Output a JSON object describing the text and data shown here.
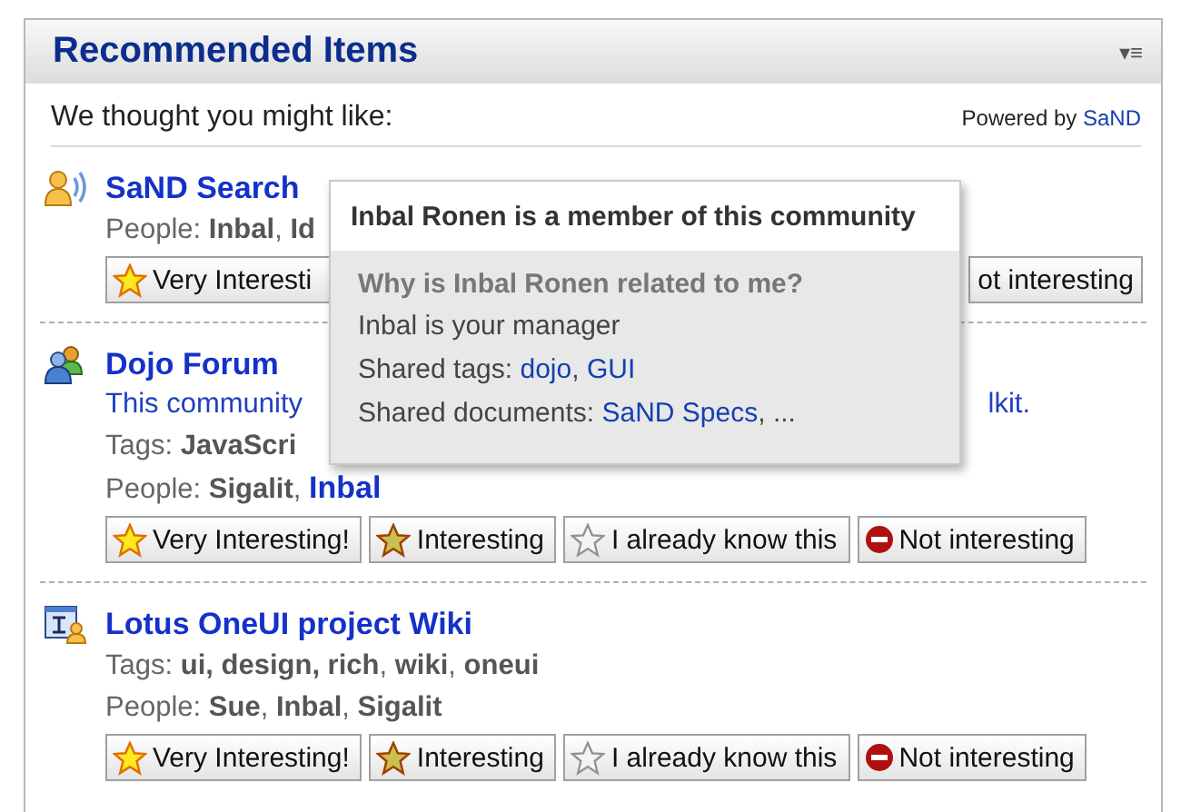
{
  "panel": {
    "title": "Recommended Items",
    "menu_glyph": "▾≡",
    "intro": "We thought you might like:",
    "powered_label": "Powered by",
    "powered_link": "SaND"
  },
  "items": [
    {
      "kind": "community",
      "title": "SaND Search",
      "lines": [
        [
          {
            "text": "People: **Inbal**, **Id**",
            "kind": "plain"
          }
        ]
      ],
      "buttons": [
        {
          "label": "Very Interesti",
          "kind": "very"
        },
        {
          "label": "ot interesting",
          "kind": "plain"
        }
      ],
      "buttons_split": true
    },
    {
      "kind": "forum",
      "title": "Dojo Forum",
      "description": [
        "This community",
        "lkit."
      ],
      "lines": [
        [
          {
            "text": "Tags: **JavaScri**",
            "kind": "plain"
          }
        ],
        [
          {
            "text": "People:  **Sigalit**,  ",
            "kind": "plain"
          },
          {
            "text": "Inbal",
            "kind": "link"
          }
        ]
      ],
      "buttons": [
        {
          "label": "Very Interesting!",
          "kind": "very"
        },
        {
          "label": "Interesting",
          "kind": "interesting"
        },
        {
          "label": "I already know this",
          "kind": "know"
        },
        {
          "label": "Not interesting",
          "kind": "not"
        }
      ],
      "buttons_split": false
    },
    {
      "kind": "wiki",
      "title": "Lotus OneUI project Wiki",
      "lines": [
        [
          {
            "text": "Tags: **ui, design, rich**, **wiki**, **oneui**",
            "kind": "plain"
          }
        ],
        [
          {
            "text": "People: **Sue**, **Inbal**, **Sigalit**",
            "kind": "plain"
          }
        ]
      ],
      "buttons": [
        {
          "label": "Very Interesting!",
          "kind": "very"
        },
        {
          "label": "Interesting",
          "kind": "interesting"
        },
        {
          "label": "I already know this",
          "kind": "know"
        },
        {
          "label": "Not interesting",
          "kind": "not"
        }
      ],
      "buttons_split": false
    }
  ],
  "tooltip": {
    "title": "Inbal Ronen is a member of this community",
    "question": "Why is Inbal Ronen related to me?",
    "reason": "Inbal is your manager",
    "lines": [
      [
        {
          "text": "Shared tags: ",
          "kind": "plain"
        },
        {
          "text": "dojo",
          "kind": "link"
        },
        {
          "text": ", ",
          "kind": "plain"
        },
        {
          "text": "GUI",
          "kind": "link"
        }
      ],
      [
        {
          "text": "Shared documents: ",
          "kind": "plain"
        },
        {
          "text": "SaND Specs",
          "kind": "link"
        },
        {
          "text": ", ...",
          "kind": "plain"
        }
      ]
    ]
  }
}
